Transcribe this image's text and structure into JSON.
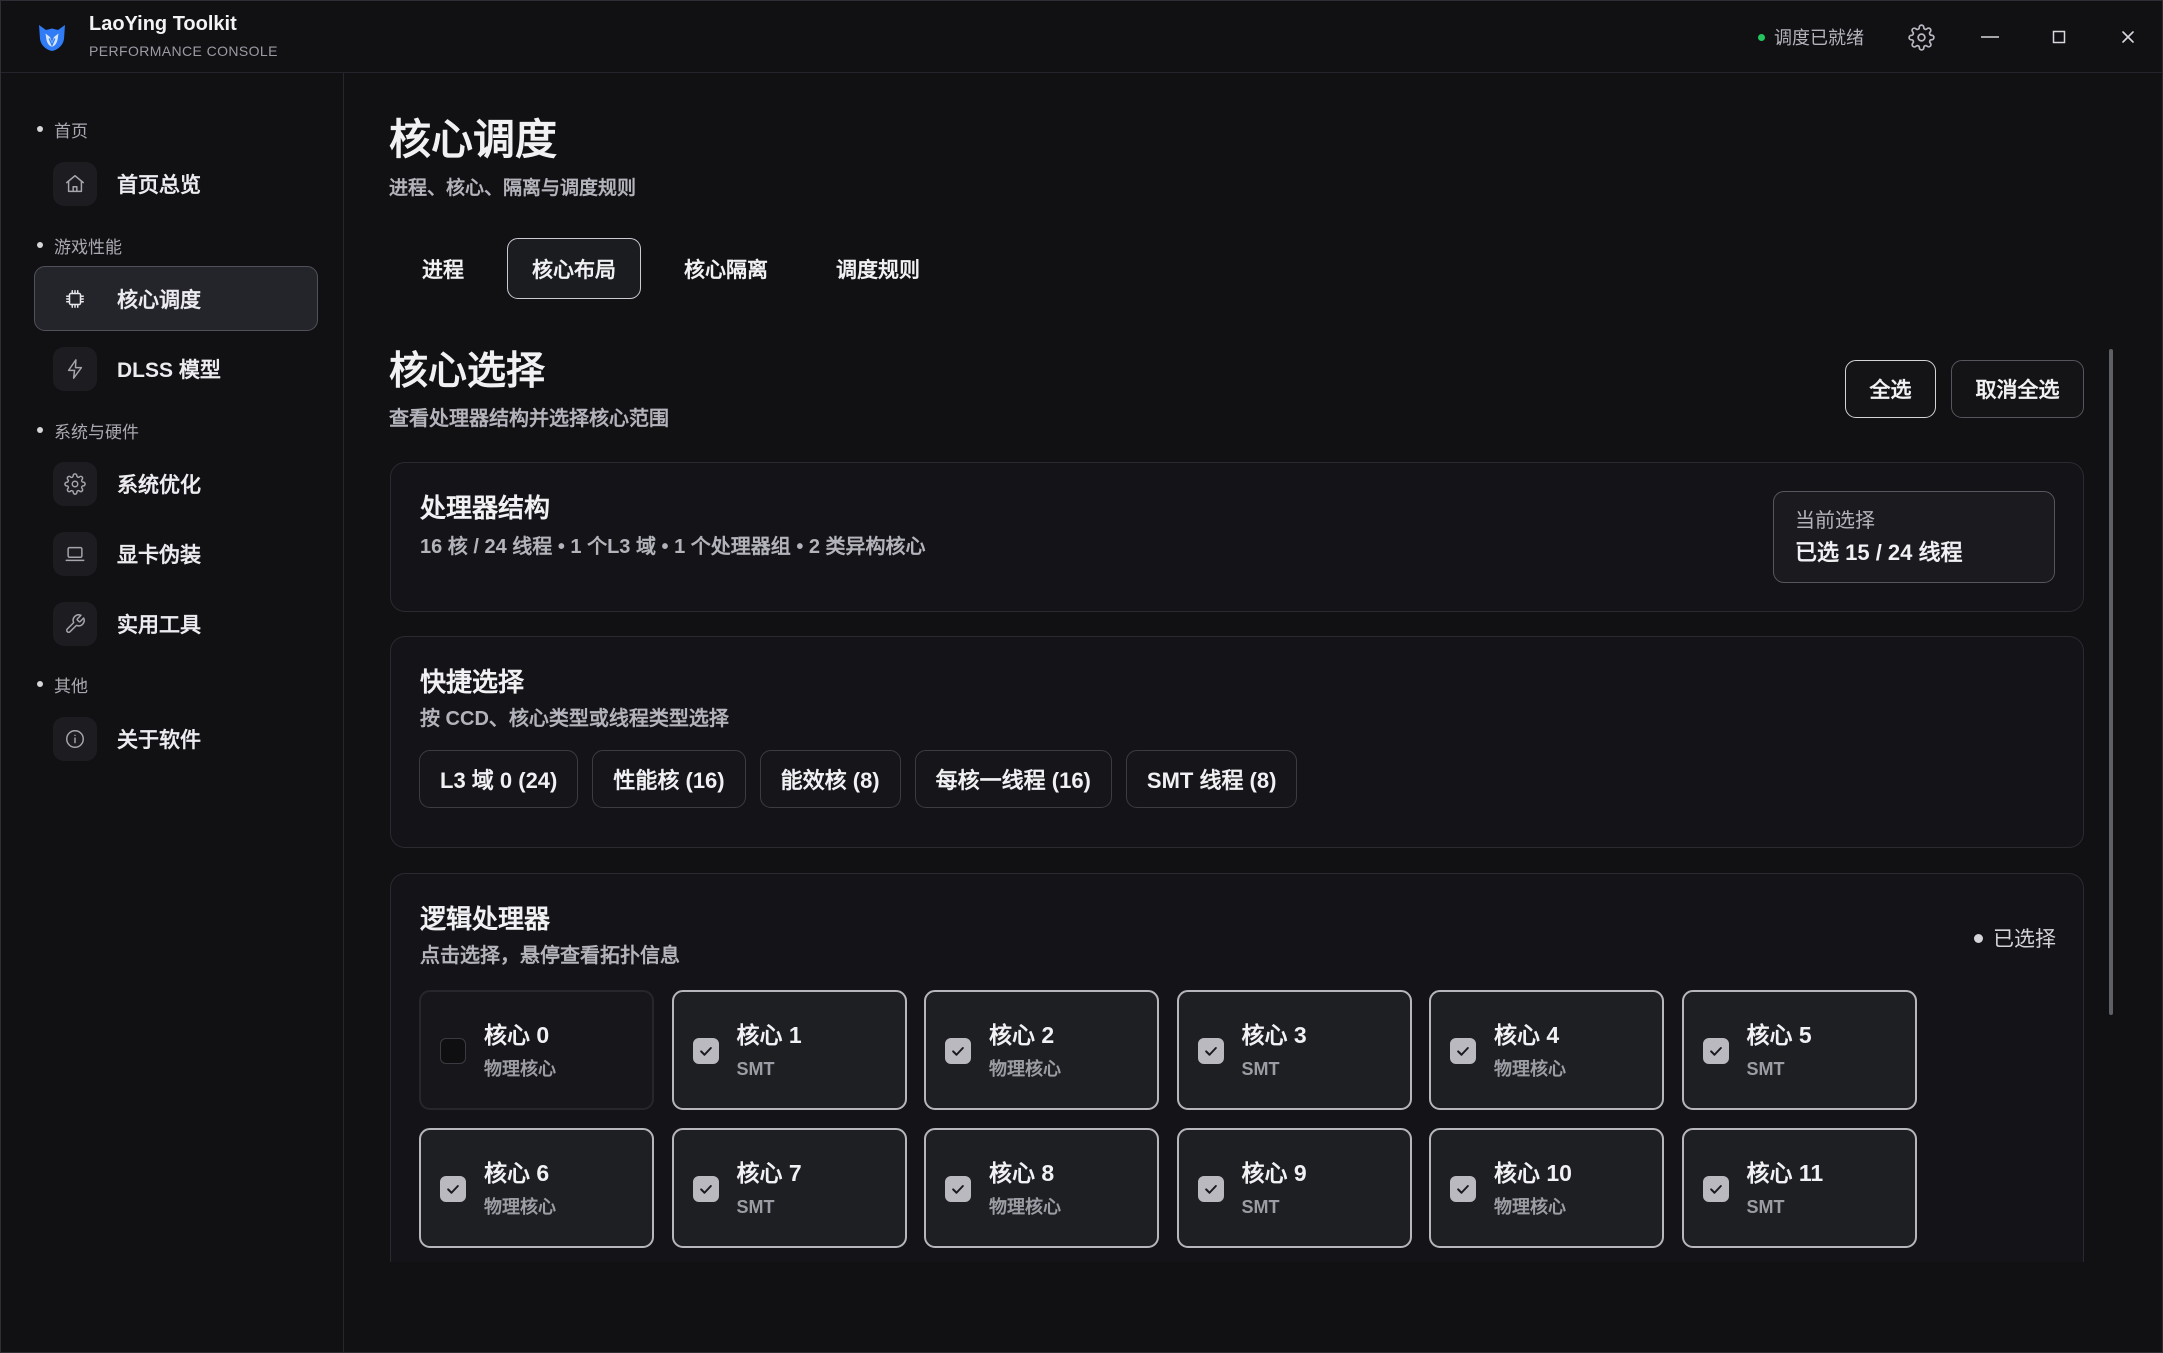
{
  "app": {
    "title": "LaoYing Toolkit",
    "subtitle": "PERFORMANCE CONSOLE",
    "logo": "owl-logo",
    "status_text": "调度已就绪",
    "status_color": "#22c55e",
    "brand_color": "#2f7cf6"
  },
  "window_controls": [
    "gear-icon",
    "minimize-icon",
    "maximize-icon",
    "close-icon"
  ],
  "sidebar": {
    "sections": [
      {
        "label": "首页",
        "items": [
          {
            "label": "首页总览",
            "icon": "home-icon",
            "active": false
          }
        ]
      },
      {
        "label": "游戏性能",
        "items": [
          {
            "label": "核心调度",
            "icon": "cpu-icon",
            "active": true
          },
          {
            "label": "DLSS 模型",
            "icon": "bolt-icon",
            "active": false
          }
        ]
      },
      {
        "label": "系统与硬件",
        "items": [
          {
            "label": "系统优化",
            "icon": "gear-icon",
            "active": false
          },
          {
            "label": "显卡伪装",
            "icon": "laptop-icon",
            "active": false
          },
          {
            "label": "实用工具",
            "icon": "wrench-icon",
            "active": false
          }
        ]
      },
      {
        "label": "其他",
        "items": [
          {
            "label": "关于软件",
            "icon": "info-icon",
            "active": false
          }
        ]
      }
    ]
  },
  "page": {
    "title": "核心调度",
    "subtitle": "进程、核心、隔离与调度规则"
  },
  "tabs": [
    {
      "label": "进程",
      "active": false
    },
    {
      "label": "核心布局",
      "active": true
    },
    {
      "label": "核心隔离",
      "active": false
    },
    {
      "label": "调度规则",
      "active": false
    }
  ],
  "core_selection": {
    "title": "核心选择",
    "subtitle": "查看处理器结构并选择核心范围",
    "select_all_label": "全选",
    "deselect_all_label": "取消全选"
  },
  "processor": {
    "title": "处理器结构",
    "summary": "16 核 / 24 线程 • 1 个L3 域 • 1 个处理器组 • 2 类异构核心",
    "selection_label": "当前选择",
    "selection_value": "已选 15 / 24 线程"
  },
  "quick_select": {
    "title": "快捷选择",
    "subtitle": "按 CCD、核心类型或线程类型选择",
    "chips": [
      "L3 域 0 (24)",
      "性能核 (16)",
      "能效核 (8)",
      "每核一线程 (16)",
      "SMT 线程 (8)"
    ]
  },
  "logical_processors": {
    "title": "逻辑处理器",
    "subtitle": "点击选择，悬停查看拓扑信息",
    "legend": "已选择",
    "cores": [
      {
        "label": "核心 0",
        "type": "物理核心",
        "selected": false
      },
      {
        "label": "核心 1",
        "type": "SMT",
        "selected": true
      },
      {
        "label": "核心 2",
        "type": "物理核心",
        "selected": true
      },
      {
        "label": "核心 3",
        "type": "SMT",
        "selected": true
      },
      {
        "label": "核心 4",
        "type": "物理核心",
        "selected": true
      },
      {
        "label": "核心 5",
        "type": "SMT",
        "selected": true
      },
      {
        "label": "核心 6",
        "type": "物理核心",
        "selected": true
      },
      {
        "label": "核心 7",
        "type": "SMT",
        "selected": true
      },
      {
        "label": "核心 8",
        "type": "物理核心",
        "selected": true
      },
      {
        "label": "核心 9",
        "type": "SMT",
        "selected": true
      },
      {
        "label": "核心 10",
        "type": "物理核心",
        "selected": true
      },
      {
        "label": "核心 11",
        "type": "SMT",
        "selected": true
      }
    ]
  }
}
